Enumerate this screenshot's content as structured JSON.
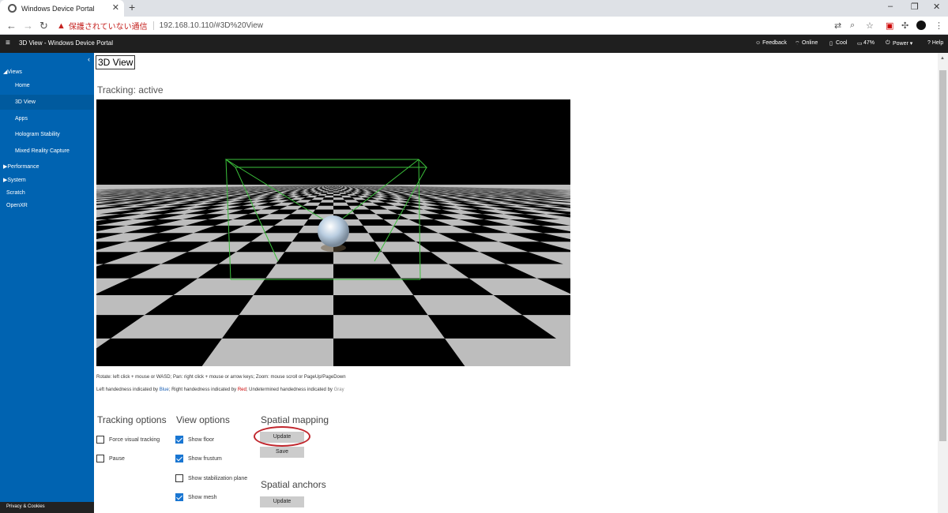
{
  "browser": {
    "tab_title": "Windows Device Portal",
    "new_tab": "+",
    "close_tab": "✕",
    "warning_text": "保護されていない通信",
    "url": "192.168.10.110/#3D%20View",
    "min_btn": "–",
    "max_btn": "❐",
    "close_btn": "✕"
  },
  "appbar": {
    "title": "3D View - Windows Device Portal",
    "feedback": "☺ Feedback",
    "online": "Online",
    "cool": "Cool",
    "battery": "47%",
    "power": "Power ▾",
    "help": "? Help"
  },
  "sidebar": {
    "views": "◢Views",
    "items": [
      "Home",
      "3D View",
      "Apps",
      "Hologram Stability",
      "Mixed Reality Capture"
    ],
    "performance": "▶Performance",
    "system": "▶System",
    "scratch": "Scratch",
    "openxr": "OpenXR",
    "privacy": "Privacy & Cookies"
  },
  "main": {
    "title": "3D View",
    "tracking": "Tracking: active",
    "hint1": "Rotate: left click + mouse or WASD; Pan: right click + mouse or arrow keys; Zoom: mouse scroll or PageUp/PageDown",
    "hint2_a": "Left handedness indicated by ",
    "hint2_blue": "Blue",
    "hint2_b": "; Right handedness indicated by ",
    "hint2_red": "Red",
    "hint2_c": "; Undetermined handedness indicated by ",
    "hint2_gray": "Gray",
    "tracking_options": {
      "heading": "Tracking options",
      "items": [
        {
          "label": "Force visual tracking",
          "checked": false
        },
        {
          "label": "Pause",
          "checked": false
        }
      ]
    },
    "view_options": {
      "heading": "View options",
      "items": [
        {
          "label": "Show floor",
          "checked": true
        },
        {
          "label": "Show frustum",
          "checked": true
        },
        {
          "label": "Show stabilization plane",
          "checked": false
        },
        {
          "label": "Show mesh",
          "checked": true
        }
      ]
    },
    "spatial_mapping": {
      "heading": "Spatial mapping",
      "update": "Update",
      "save": "Save"
    },
    "spatial_anchors": {
      "heading": "Spatial anchors",
      "update": "Update"
    }
  },
  "colors": {
    "sidebar": "#0063b1",
    "appbar": "#1f1f1f",
    "highlight": "#c0262d",
    "checkbox": "#1976d2"
  }
}
